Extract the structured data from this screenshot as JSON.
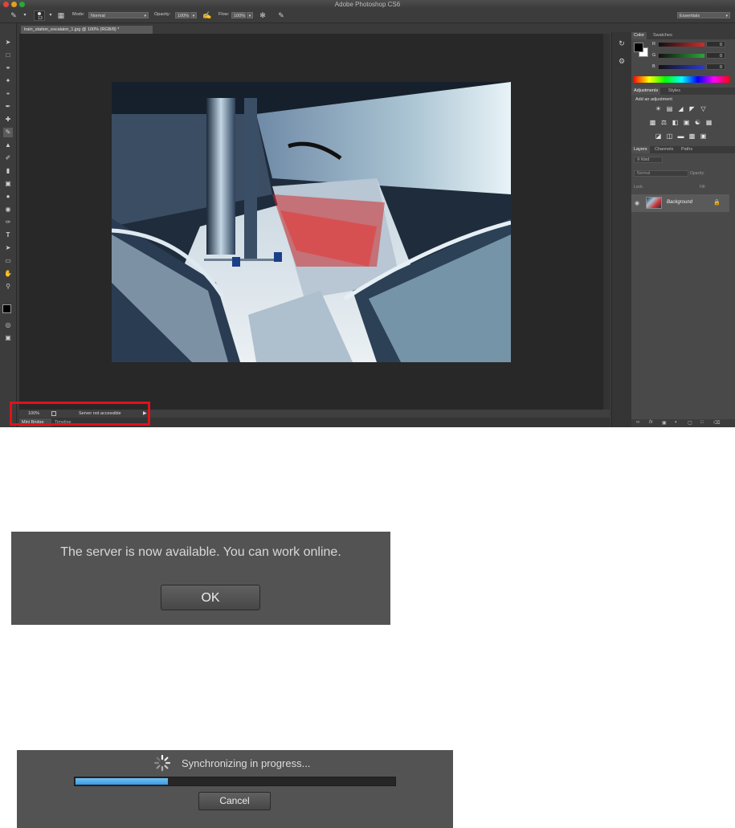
{
  "window": {
    "title": "Adobe Photoshop CS6"
  },
  "options_bar": {
    "brush_size": "13",
    "mode_label": "Mode:",
    "mode_value": "Normal",
    "opacity_label": "Opacity:",
    "opacity_value": "100%",
    "flow_label": "Flow:",
    "flow_value": "100%",
    "workspace": "Essentials"
  },
  "document": {
    "tab_title": "train_station_escalator_1.jpg @ 100% (RGB/8) *"
  },
  "status_bar": {
    "zoom": "100%",
    "message": "Server not accessible"
  },
  "bottom_tabs": [
    "Mini Bridge",
    "Timeline"
  ],
  "panels": {
    "color": {
      "tabs": [
        "Color",
        "Swatches"
      ],
      "channels": [
        {
          "label": "R",
          "value": "0",
          "color": "#d42a2a"
        },
        {
          "label": "G",
          "value": "0",
          "color": "#2aa63a"
        },
        {
          "label": "B",
          "value": "0",
          "color": "#2a3ad4"
        }
      ]
    },
    "adjustments": {
      "tabs": [
        "Adjustments",
        "Styles"
      ],
      "heading": "Add an adjustment"
    },
    "layers": {
      "tabs": [
        "Layers",
        "Channels",
        "Paths"
      ],
      "kind_label": "Kind",
      "blend_mode": "Normal",
      "opacity_label": "Opacity:",
      "lock_label": "Lock:",
      "fill_label": "Fill:",
      "layer_name": "Background"
    }
  },
  "dialog_online": {
    "message": "The server is now available. You can work online.",
    "ok_label": "OK"
  },
  "dialog_sync": {
    "message": "Synchronizing in progress...",
    "progress": 0.29,
    "cancel_label": "Cancel",
    "accent_color": "#3d9be3"
  },
  "highlight_color": "#e0121a"
}
